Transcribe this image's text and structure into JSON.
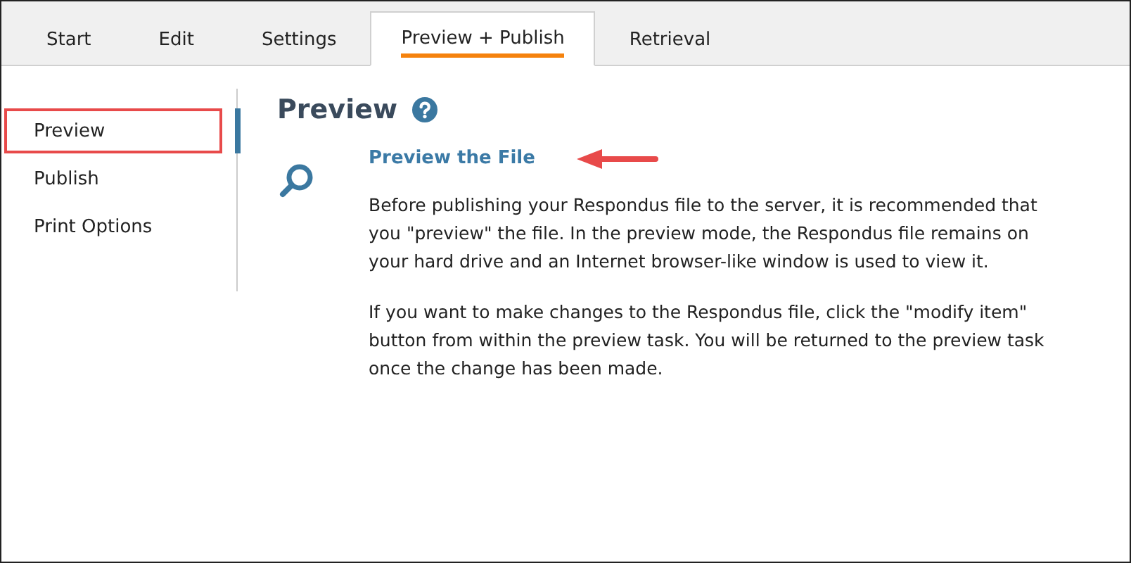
{
  "tabs": [
    {
      "label": "Start",
      "selected": false
    },
    {
      "label": "Edit",
      "selected": false
    },
    {
      "label": "Settings",
      "selected": false
    },
    {
      "label": "Preview + Publish",
      "selected": true
    },
    {
      "label": "Retrieval",
      "selected": false
    }
  ],
  "sidebar": {
    "items": [
      {
        "label": "Preview",
        "selected": true
      },
      {
        "label": "Publish",
        "selected": false
      },
      {
        "label": "Print Options",
        "selected": false
      }
    ]
  },
  "content": {
    "title": "Preview",
    "task": {
      "title": "Preview the File",
      "paragraphs": [
        "Before publishing your Respondus file to the server, it is recommended that you \"preview\" the file.  In the preview mode, the Respondus file remains on your hard drive and an Internet browser-like window is used to view it.",
        "If you want to make changes to the Respondus file, click the \"modify item\" button from within the preview task.  You will be returned to the preview task once the change has been made."
      ]
    }
  }
}
